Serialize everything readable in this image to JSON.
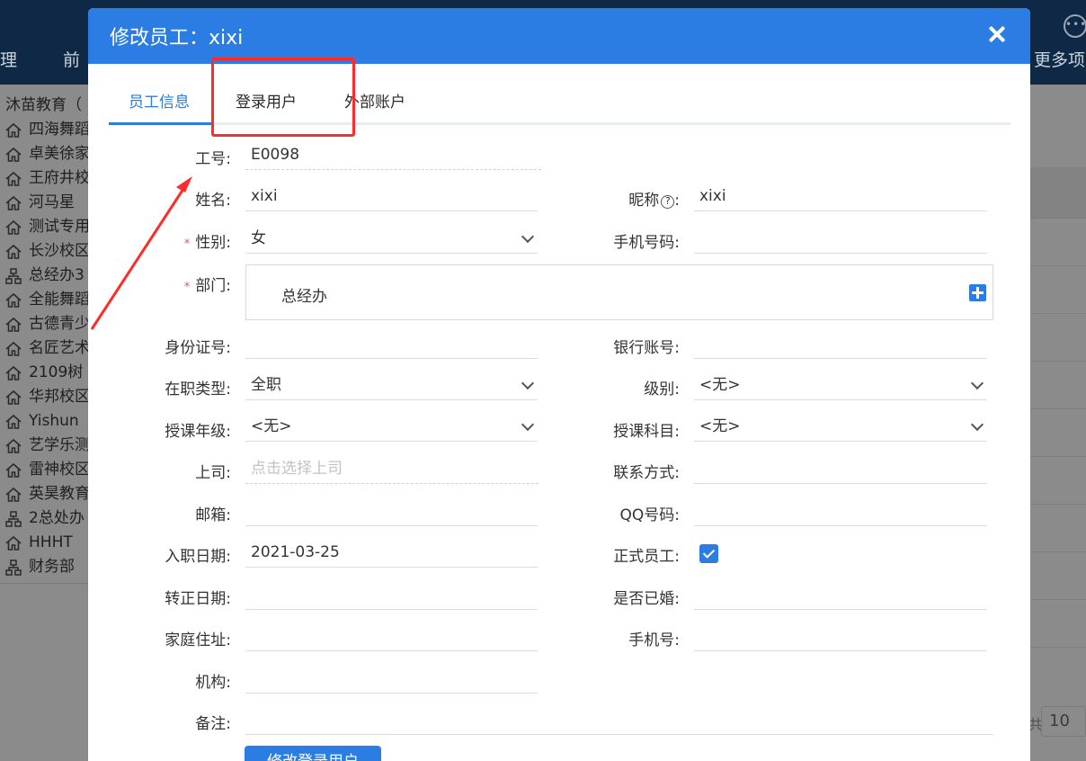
{
  "background": {
    "nav_items": [
      "理",
      "前",
      "更多项"
    ],
    "tree": {
      "root": "沐苗教育（",
      "items": [
        {
          "label": "四海舞蹈",
          "icon": "home-icon"
        },
        {
          "label": "卓美徐家",
          "icon": "home-icon"
        },
        {
          "label": "王府井校",
          "icon": "home-icon"
        },
        {
          "label": "河马星",
          "icon": "home-icon"
        },
        {
          "label": "测试专用",
          "icon": "home-icon"
        },
        {
          "label": "长沙校区",
          "icon": "home-icon"
        },
        {
          "label": "总经办3",
          "icon": "org-icon"
        },
        {
          "label": "全能舞蹈",
          "icon": "home-icon"
        },
        {
          "label": "古德青少",
          "icon": "home-icon"
        },
        {
          "label": "名匠艺术",
          "icon": "home-icon"
        },
        {
          "label": "2109树",
          "icon": "home-icon"
        },
        {
          "label": "华邦校区",
          "icon": "home-icon"
        },
        {
          "label": "Yishun",
          "icon": "home-icon"
        },
        {
          "label": "艺学乐测",
          "icon": "home-icon"
        },
        {
          "label": "雷神校区",
          "icon": "home-icon"
        },
        {
          "label": "英昊教育",
          "icon": "home-icon"
        },
        {
          "label": "2总处办",
          "icon": "org-icon"
        },
        {
          "label": "HHHT",
          "icon": "home-icon"
        },
        {
          "label": "财务部",
          "icon": "org-icon"
        }
      ]
    },
    "page_size": "10",
    "page_sep": "共"
  },
  "modal": {
    "title": "修改员工：xixi",
    "tabs": [
      "员工信息",
      "登录用户",
      "外部账户"
    ],
    "fields": {
      "emp_no": {
        "label": "工号:",
        "value": "E0098"
      },
      "name": {
        "label": "姓名:",
        "value": "xixi"
      },
      "nickname": {
        "label": "昵称",
        "value": "xixi"
      },
      "gender": {
        "label": "性别:",
        "value": "女"
      },
      "phone_no": {
        "label": "手机号码:",
        "value": ""
      },
      "dept": {
        "label": "部门:",
        "value": "总经办"
      },
      "id_card": {
        "label": "身份证号:",
        "value": ""
      },
      "bank_account": {
        "label": "银行账号:",
        "value": ""
      },
      "employment_type": {
        "label": "在职类型:",
        "value": "全职"
      },
      "level": {
        "label": "级别:",
        "value": "<无>"
      },
      "grade": {
        "label": "授课年级:",
        "value": "<无>"
      },
      "subject": {
        "label": "授课科目:",
        "value": "<无>"
      },
      "superior": {
        "label": "上司:",
        "placeholder": "点击选择上司"
      },
      "contact": {
        "label": "联系方式:",
        "value": ""
      },
      "email": {
        "label": "邮箱:",
        "value": ""
      },
      "qq": {
        "label": "QQ号码:",
        "value": ""
      },
      "hire_date": {
        "label": "入职日期:",
        "value": "2021-03-25"
      },
      "formal": {
        "label": "正式员工:",
        "checked": true
      },
      "regular_date": {
        "label": "转正日期:",
        "value": ""
      },
      "married": {
        "label": "是否已婚:",
        "value": ""
      },
      "address": {
        "label": "家庭住址:",
        "value": ""
      },
      "mobile": {
        "label": "手机号:",
        "value": ""
      },
      "org": {
        "label": "机构:",
        "value": ""
      },
      "remark": {
        "label": "备注:",
        "value": ""
      }
    },
    "button": "修改登录用户",
    "required_mark": "*",
    "help_mark": "?"
  },
  "colors": {
    "accent": "#2b7de4",
    "annotation": "#ff2b2b"
  }
}
